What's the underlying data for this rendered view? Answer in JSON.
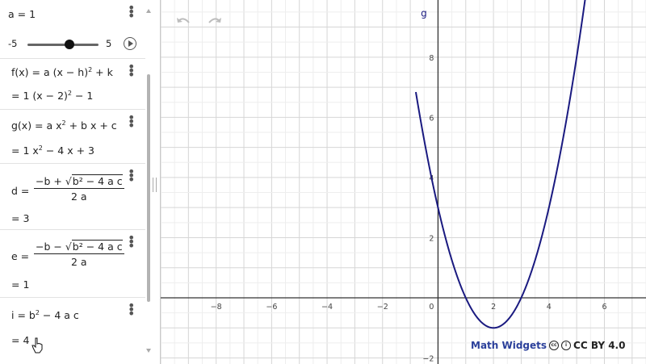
{
  "slider": {
    "label": "a = 1",
    "min": "-5",
    "max": "5",
    "value": 1
  },
  "rows": {
    "f_def": "f(x) = a (x − h)",
    "f_def_tail": " + k",
    "f_val": "=  1 (x − 2)",
    "f_val_tail": " − 1",
    "g_def": "g(x) = a x",
    "g_def_mid": " + b x + c",
    "g_val": "=  1 x",
    "g_val_tail": " − 4 x + 3",
    "d_label": "d  =",
    "d_num_pre": "−b + √",
    "d_num_rad": "b² − 4 a c",
    "d_den": "2 a",
    "d_val": "=  3",
    "e_label": "e  =",
    "e_num_pre": "−b − √",
    "e_num_rad": "b² − 4 a c",
    "e_den": "2 a",
    "e_val": "=  1",
    "i_def": "i  =  b",
    "i_def_tail": " − 4 a c",
    "i_val": "=  4",
    "sup2": "2"
  },
  "graph": {
    "curve_label": "g",
    "x_ticks": [
      "−8",
      "−6",
      "−4",
      "−2",
      "0",
      "2",
      "4",
      "6"
    ],
    "y_ticks": [
      "8",
      "6",
      "4",
      "2",
      "−2"
    ]
  },
  "watermark": {
    "brand": "Math Widgets",
    "cc": "cc",
    "by": "i",
    "license": "CC BY 4.0"
  },
  "colors": {
    "curve": "#1a1a80",
    "grid_minor": "#eeeeee",
    "grid_major": "#d6d6d6",
    "axis": "#333333"
  },
  "icons": {
    "undo": "undo-icon",
    "redo": "redo-icon",
    "menu": "kebab-menu-icon",
    "play": "play-icon"
  },
  "chart_data": {
    "type": "line",
    "series": [
      {
        "name": "g",
        "function": "x^2 - 4x + 3",
        "x": [
          -0.5,
          0,
          1,
          2,
          3,
          4,
          5.2
        ],
        "y": [
          5.25,
          3,
          0,
          -1,
          0,
          3,
          9.24
        ]
      }
    ],
    "xlim": [
      -10,
      7.5
    ],
    "ylim": [
      -2.2,
      9.9
    ],
    "grid": true
  }
}
